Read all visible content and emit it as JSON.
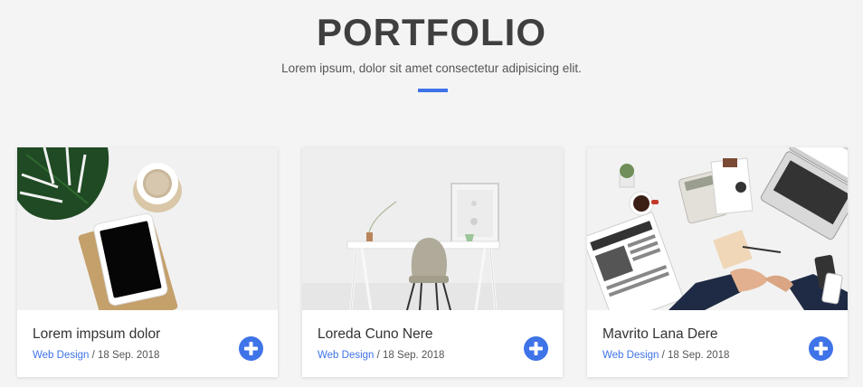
{
  "section": {
    "title": "PORTFOLIO",
    "subtitle": "Lorem ipsum, dolor sit amet consectetur adipisicing elit.",
    "accent_color": "#3f73e8"
  },
  "cards": [
    {
      "title": "Lorem impsum dolor",
      "category": "Web Design",
      "separator": " / ",
      "date": "18 Sep. 2018",
      "image": "desk-with-tablet-coffee-and-plant",
      "action_icon": "plus-circle-icon"
    },
    {
      "title": "Loreda Cuno Nere",
      "category": "Web Design",
      "separator": " / ",
      "date": "18 Sep. 2018",
      "image": "white-desk-with-chair",
      "action_icon": "plus-circle-icon"
    },
    {
      "title": "Mavrito Lana Dere",
      "category": "Web Design",
      "separator": " / ",
      "date": "18 Sep. 2018",
      "image": "office-desk-with-laptop-newspaper",
      "action_icon": "plus-circle-icon"
    }
  ]
}
